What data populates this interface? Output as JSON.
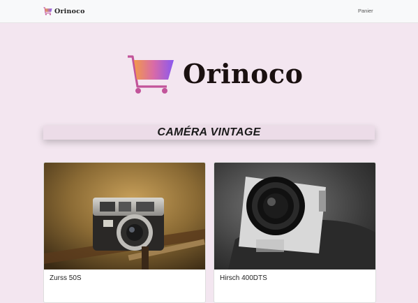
{
  "navbar": {
    "brand_text": "Orinoco",
    "cart_link": "Panier"
  },
  "hero": {
    "logo_text": "Orinoco"
  },
  "section": {
    "title": "CAMÉRA VINTAGE"
  },
  "products": [
    {
      "name": "Zurss 50S",
      "image": "camera-photo-sepia"
    },
    {
      "name": "Hirsch 400DTS",
      "image": "camera-lens-bw"
    }
  ],
  "colors": {
    "background": "#f3e6f0",
    "logo_gradient_start": "#f29a4a",
    "logo_gradient_end": "#8a58f0"
  }
}
